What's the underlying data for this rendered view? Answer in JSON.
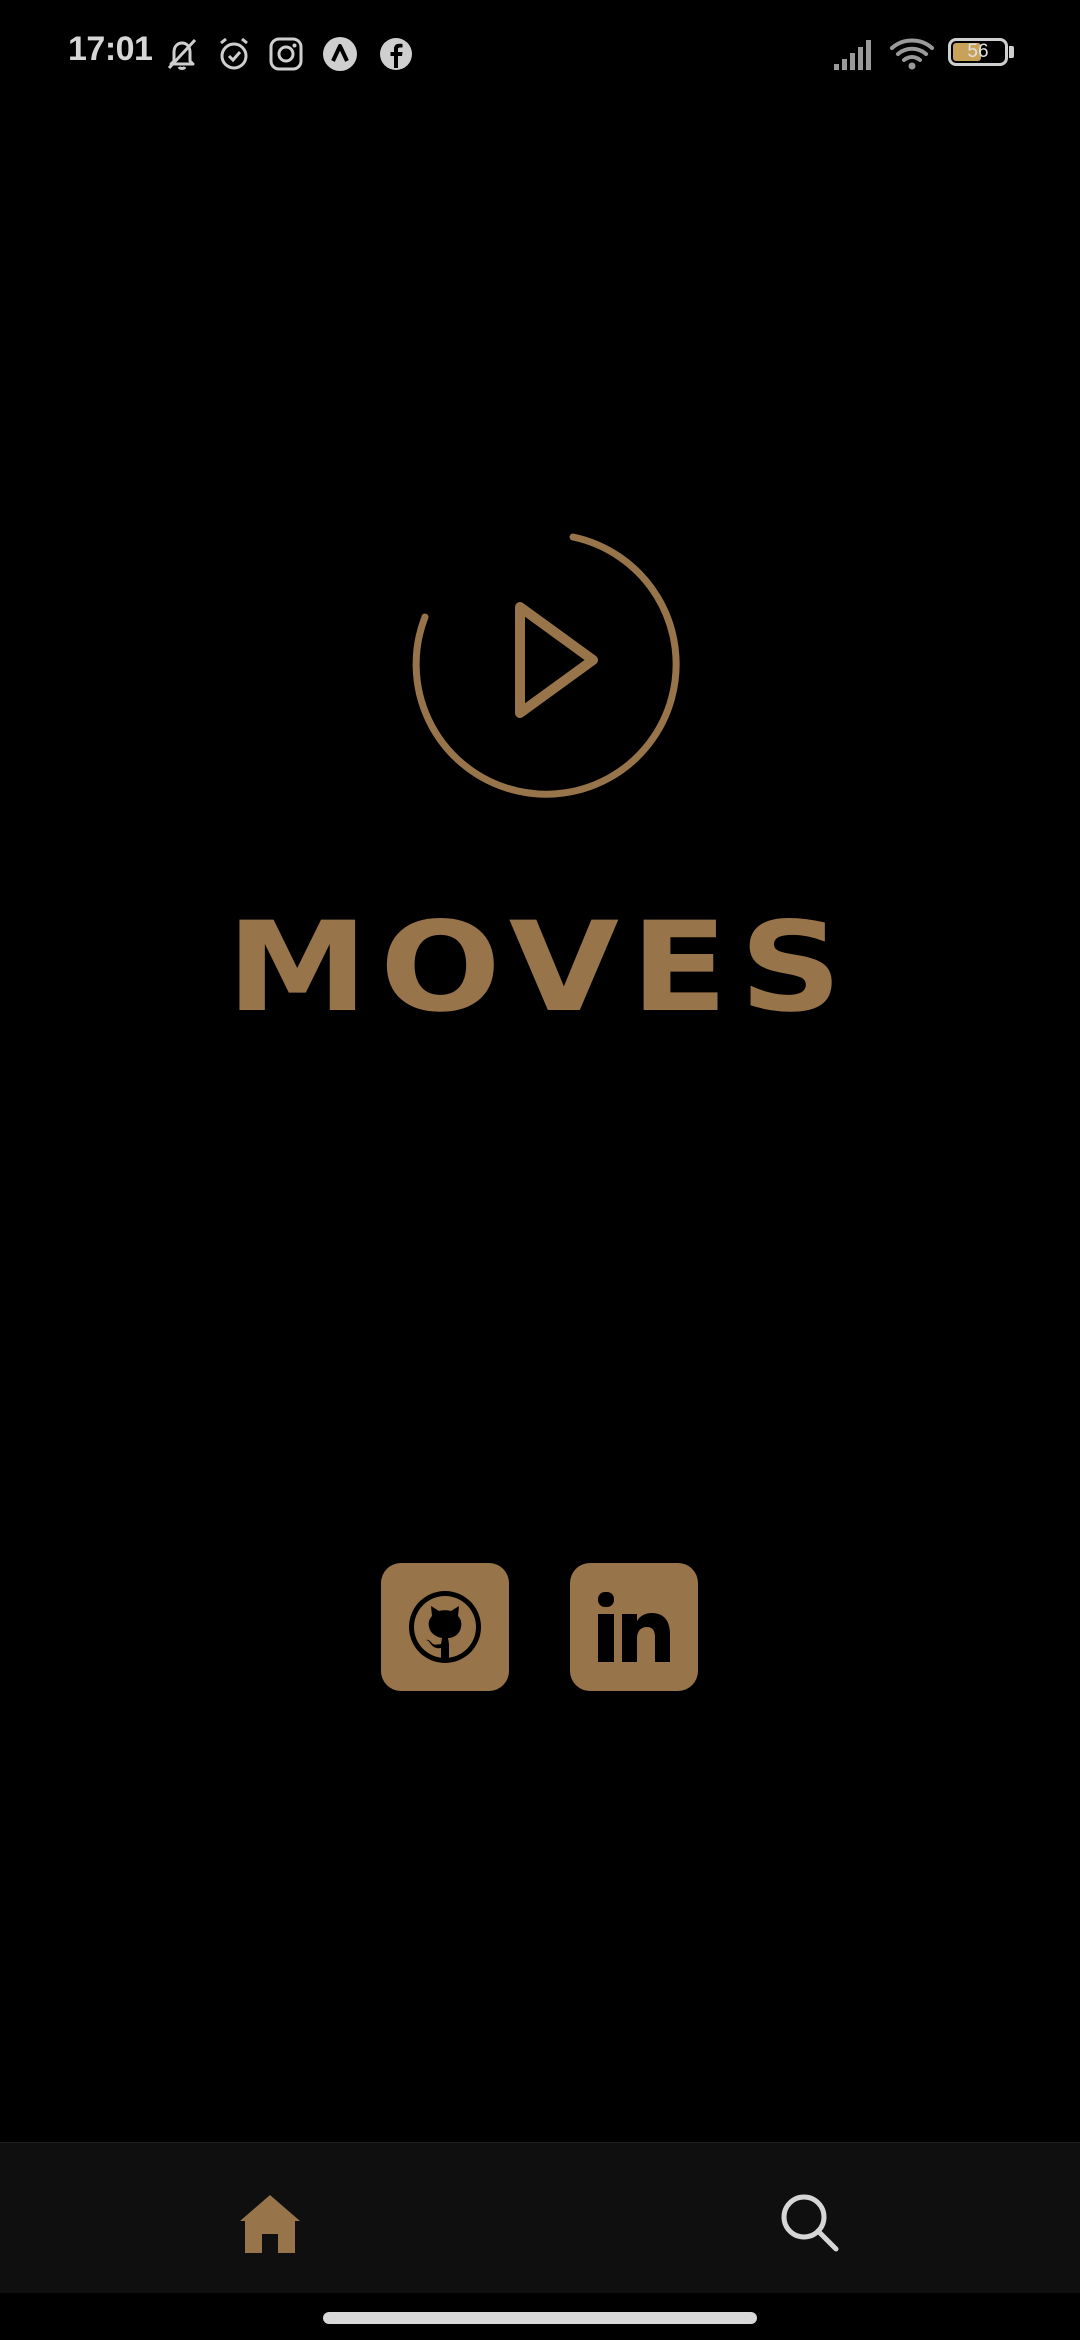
{
  "status_bar": {
    "time": "17:01",
    "notification_icons": [
      "bell-off-icon",
      "alarm-icon",
      "instagram-icon",
      "app-a-icon",
      "facebook-icon"
    ],
    "battery_level": "56",
    "battery_percent": 56
  },
  "brand": {
    "title": "MOVES",
    "logo_icon": "play-circle-icon",
    "accent_color": "#98744a"
  },
  "social": {
    "links": [
      {
        "icon": "github-icon"
      },
      {
        "icon": "linkedin-icon",
        "text": "in"
      }
    ]
  },
  "bottom_nav": {
    "items": [
      {
        "icon": "home-icon",
        "active": true,
        "color": "#98744a"
      },
      {
        "icon": "search-icon",
        "active": false,
        "color": "#d6d6d6"
      }
    ]
  },
  "colors": {
    "background": "#000000",
    "nav_background": "#0f0f0f",
    "status_text": "#d6d6d6"
  }
}
